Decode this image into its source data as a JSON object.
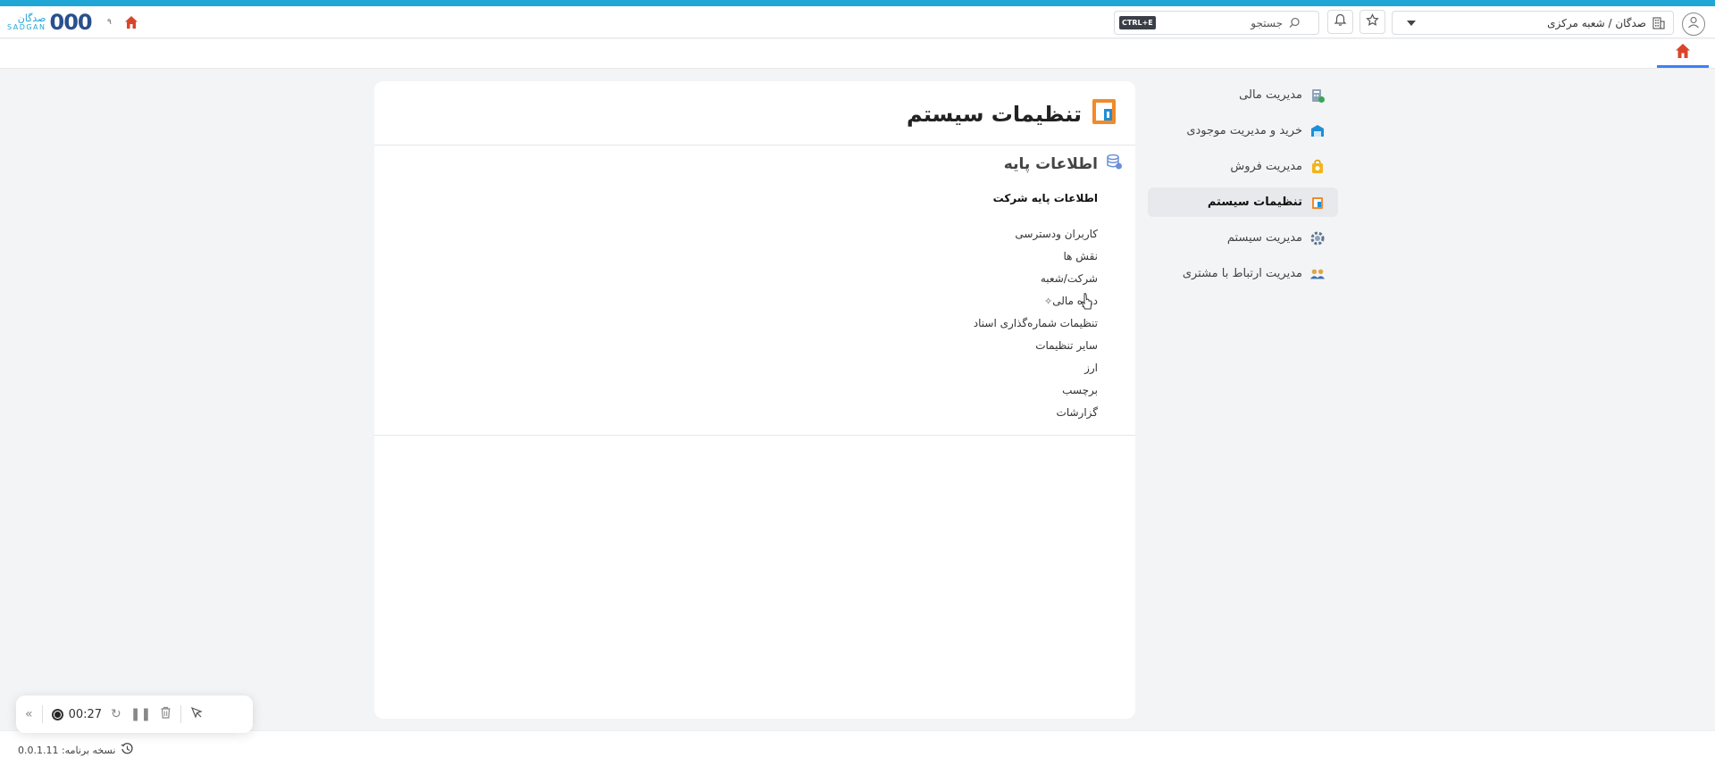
{
  "header": {
    "logo_fa": "صدگان",
    "logo_en": "SADGAN",
    "logo_mark": "000",
    "small_label": "۹",
    "search_placeholder": "جستجو",
    "search_shortcut": "CTRL+E",
    "branch": "صدگان / شعبه مرکزی"
  },
  "sidebar": {
    "items": [
      {
        "label": "مدیریت مالی",
        "icon": "finance-icon",
        "active": false
      },
      {
        "label": "خرید و مدیریت موجودی",
        "icon": "purchase-icon",
        "active": false
      },
      {
        "label": "مدیریت فروش",
        "icon": "sales-icon",
        "active": false
      },
      {
        "label": "تنظیمات سیستم",
        "icon": "system-settings-icon",
        "active": true
      },
      {
        "label": "مدیریت سیستم",
        "icon": "system-management-icon",
        "active": false
      },
      {
        "label": "مدیریت ارتباط با مشتری",
        "icon": "crm-icon",
        "active": false
      }
    ]
  },
  "main": {
    "title": "تنظیمات سیستم",
    "section_title": "اطلاعات پایه",
    "subsection_title": "اطلاعات پایه شرکت",
    "links": [
      "کاربران ودسترسی",
      "نقش ها",
      "شرکت/شعبه",
      "دوره مالی",
      "تنظیمات شماره‌گذاری اسناد",
      "سایر تنظیمات",
      "ارز",
      "برچسب",
      "گزارشات"
    ]
  },
  "footer": {
    "version": "نسخه برنامه: 0.0.1.11"
  },
  "recorder": {
    "time": "00:27"
  },
  "colors": {
    "accent": "#1fa6d4",
    "active_tab_underline": "#3b82f6",
    "home_icon": "#d9452b"
  }
}
